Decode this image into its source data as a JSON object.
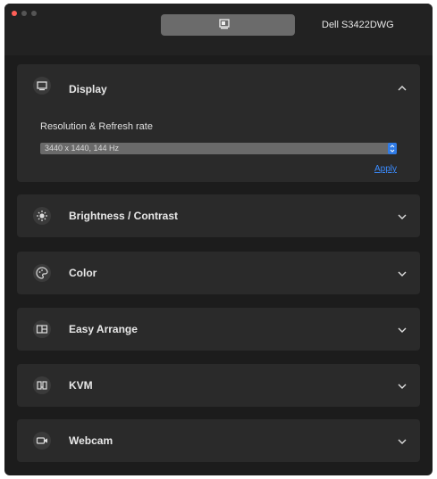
{
  "titlebar": {
    "monitor_name": "Dell S3422DWG",
    "monitor_icon": "monitor-icon"
  },
  "sections": [
    {
      "key": "display",
      "label": "Display",
      "icon": "display-icon",
      "expanded": true
    },
    {
      "key": "brightness",
      "label": "Brightness / Contrast",
      "icon": "sun-icon",
      "expanded": false
    },
    {
      "key": "color",
      "label": "Color",
      "icon": "palette-icon",
      "expanded": false
    },
    {
      "key": "easy_arrange",
      "label": "Easy Arrange",
      "icon": "layout-icon",
      "expanded": false
    },
    {
      "key": "kvm",
      "label": "KVM",
      "icon": "kvm-icon",
      "expanded": false
    },
    {
      "key": "webcam",
      "label": "Webcam",
      "icon": "webcam-icon",
      "expanded": false
    }
  ],
  "display": {
    "resolution_label": "Resolution & Refresh rate",
    "resolution_value": "3440 x 1440, 144 Hz",
    "apply_label": "Apply"
  },
  "colors": {
    "accent": "#2f7be6",
    "link": "#3b8cff",
    "close": "#ff5f57"
  }
}
